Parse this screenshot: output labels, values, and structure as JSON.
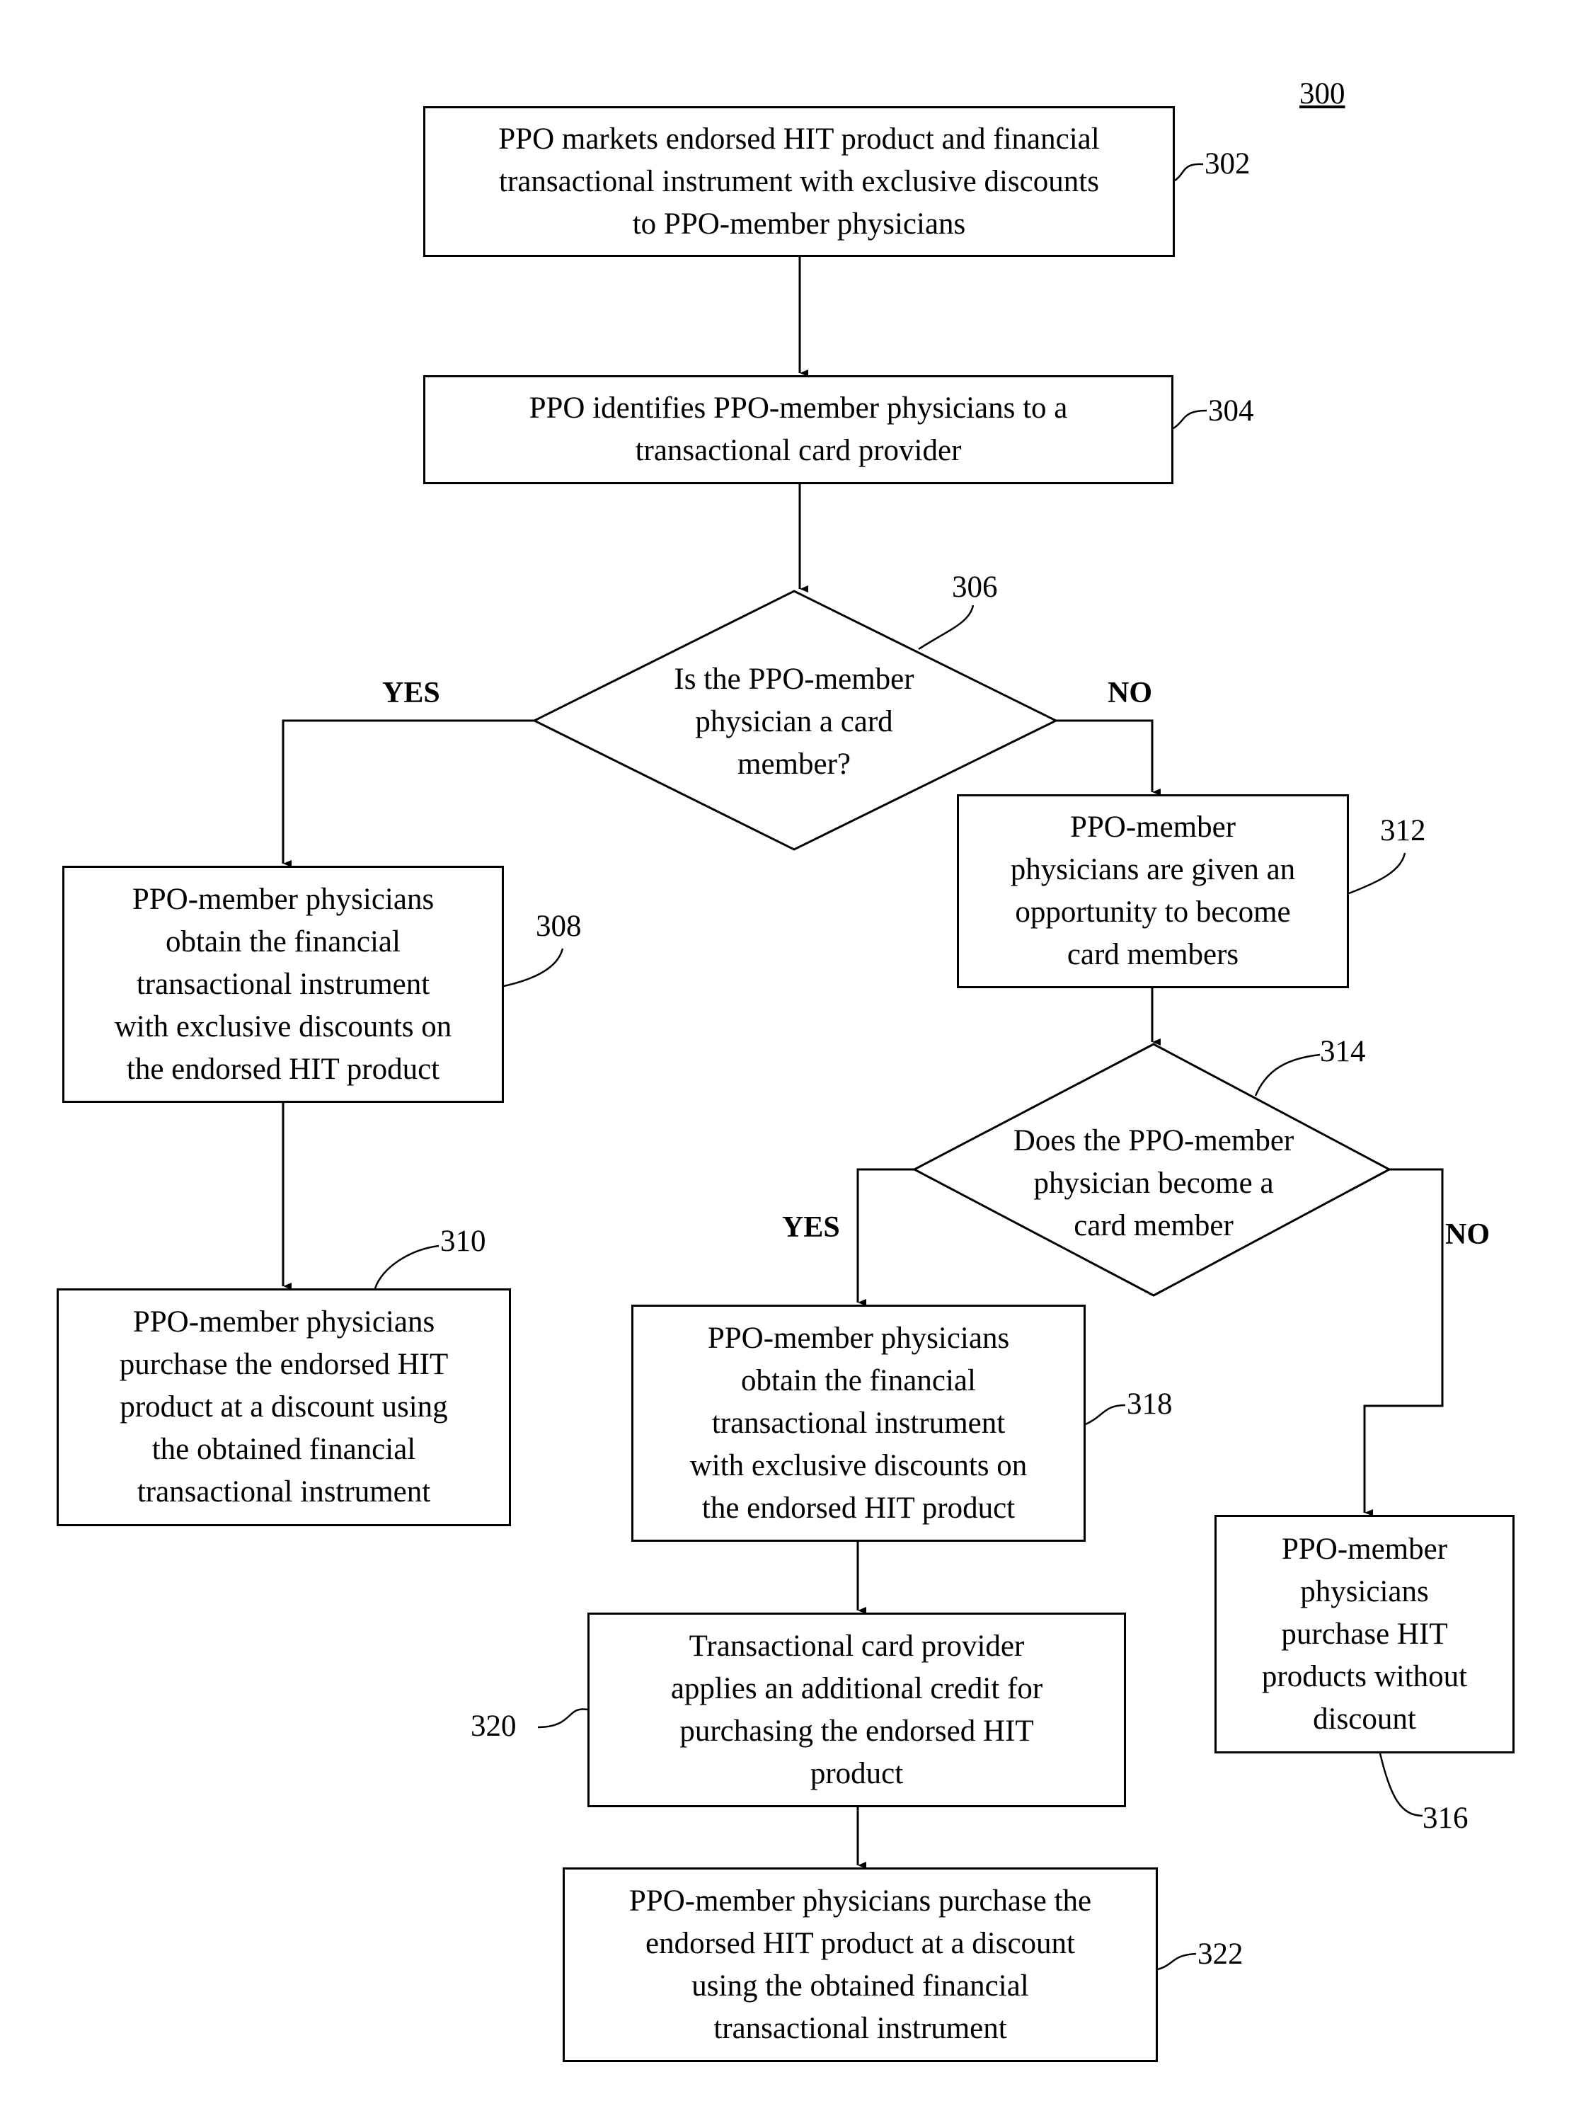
{
  "figure": {
    "number": "300"
  },
  "steps": {
    "s302": {
      "ref": "302",
      "text": "PPO markets endorsed HIT product and financial\ntransactional instrument with exclusive discounts\nto PPO-member physicians"
    },
    "s304": {
      "ref": "304",
      "text": "PPO identifies PPO-member physicians to a\ntransactional card provider"
    },
    "s306": {
      "ref": "306",
      "text": "Is the PPO-member\nphysician a card\nmember?"
    },
    "s308": {
      "ref": "308",
      "text": "PPO-member physicians\nobtain the financial\ntransactional instrument\nwith exclusive discounts on\nthe endorsed HIT product"
    },
    "s310": {
      "ref": "310",
      "text": "PPO-member physicians\npurchase the endorsed HIT\nproduct at a discount using\nthe obtained financial\ntransactional instrument"
    },
    "s312": {
      "ref": "312",
      "text": "PPO-member\nphysicians are given an\nopportunity to become\ncard members"
    },
    "s314": {
      "ref": "314",
      "text": "Does the PPO-member\nphysician become a\ncard member"
    },
    "s316": {
      "ref": "316",
      "text": "PPO-member\nphysicians\npurchase HIT\nproducts without\ndiscount"
    },
    "s318": {
      "ref": "318",
      "text": "PPO-member physicians\nobtain the financial\ntransactional instrument\nwith exclusive discounts on\nthe endorsed HIT product"
    },
    "s320": {
      "ref": "320",
      "text": "Transactional card provider\napplies an additional credit for\npurchasing the endorsed HIT\nproduct"
    },
    "s322": {
      "ref": "322",
      "text": "PPO-member physicians purchase the\nendorsed HIT product at a discount\nusing the obtained financial\ntransactional instrument"
    }
  },
  "branches": {
    "d306_yes": "YES",
    "d306_no": "NO",
    "d314_yes": "YES",
    "d314_no": "NO"
  }
}
